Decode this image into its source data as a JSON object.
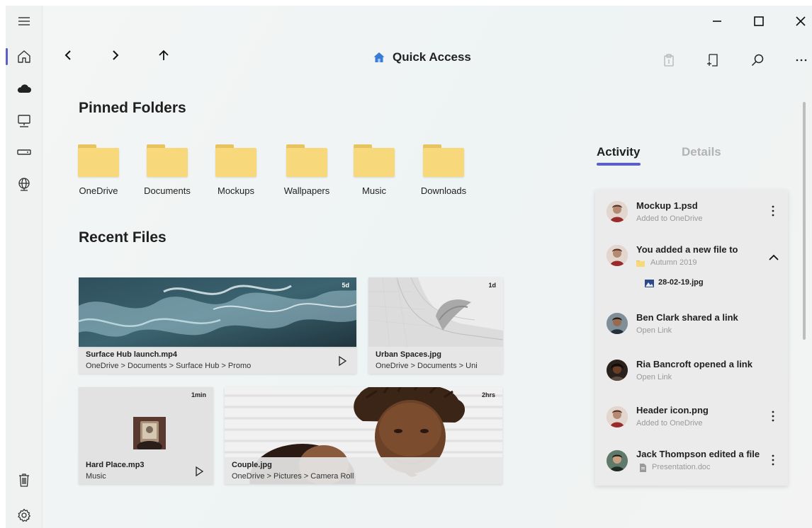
{
  "toolbar": {
    "title": "Quick Access"
  },
  "pinned": {
    "heading": "Pinned Folders",
    "folders": [
      {
        "label": "OneDrive"
      },
      {
        "label": "Documents"
      },
      {
        "label": "Mockups"
      },
      {
        "label": "Wallpapers"
      },
      {
        "label": "Music"
      },
      {
        "label": "Downloads"
      }
    ]
  },
  "recent": {
    "heading": "Recent Files",
    "files": [
      {
        "name": "Surface Hub launch.mp4",
        "path": "OneDrive > Documents > Surface Hub > Promo",
        "age": "5d"
      },
      {
        "name": "Urban Spaces.jpg",
        "path": "OneDrive > Documents > Uni",
        "age": "1d"
      },
      {
        "name": "Hard Place.mp3",
        "path": "Music",
        "age": "1min"
      },
      {
        "name": "Couple.jpg",
        "path": "OneDrive > Pictures > Camera Roll",
        "age": "2hrs"
      }
    ]
  },
  "panel": {
    "tabs": [
      {
        "label": "Activity",
        "active": true
      },
      {
        "label": "Details",
        "active": false
      }
    ],
    "activity": [
      {
        "title": "Mockup 1.psd",
        "subtitle": "Added to OneDrive"
      },
      {
        "title": "You added a new file to",
        "subtitle": "Autumn 2019",
        "child": "28-02-19.jpg"
      },
      {
        "title": "Ben Clark shared a link",
        "subtitle": "Open Link"
      },
      {
        "title": "Ria Bancroft opened a link",
        "subtitle": "Open Link"
      },
      {
        "title": "Header icon.png",
        "subtitle": "Added to OneDrive"
      },
      {
        "title": "Jack Thompson edited a file",
        "subtitle": "Presentation.doc"
      }
    ]
  },
  "colors": {
    "accent": "#5b5fc7",
    "folder": "#f7d97c",
    "home": "#3a7bd5"
  }
}
